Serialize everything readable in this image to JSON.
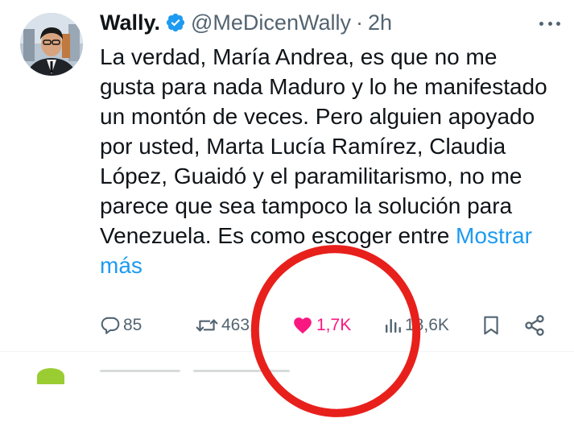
{
  "tweet": {
    "author": {
      "name": "Wally.",
      "handle": "@MeDicenWally",
      "separator": "·",
      "time": "2h"
    },
    "text": "La verdad, María Andrea, es que no me gusta para nada Maduro y lo he manifestado un montón de veces. Pero alguien apoyado por usted, Marta Lucía Ramírez, Claudia López, Guaidó y el paramilitarismo, no me parece que sea tampoco la solución para Venezuela. Es como escoger entre ",
    "show_more": "Mostrar más",
    "actions": {
      "replies": "85",
      "retweets": "463",
      "likes": "1,7K",
      "views": "18,6K"
    },
    "icons": {
      "more": "more-dots-icon",
      "verified": "verified-badge-icon",
      "reply": "reply-icon",
      "retweet": "retweet-icon",
      "like": "heart-icon",
      "views": "views-bar-chart-icon",
      "bookmark": "bookmark-icon",
      "share": "share-icon"
    },
    "colors": {
      "verified": "#1d9bf0",
      "link": "#1d9bf0",
      "like": "#f91880",
      "muted": "#536471",
      "annotation_circle": "#e8201c"
    }
  }
}
